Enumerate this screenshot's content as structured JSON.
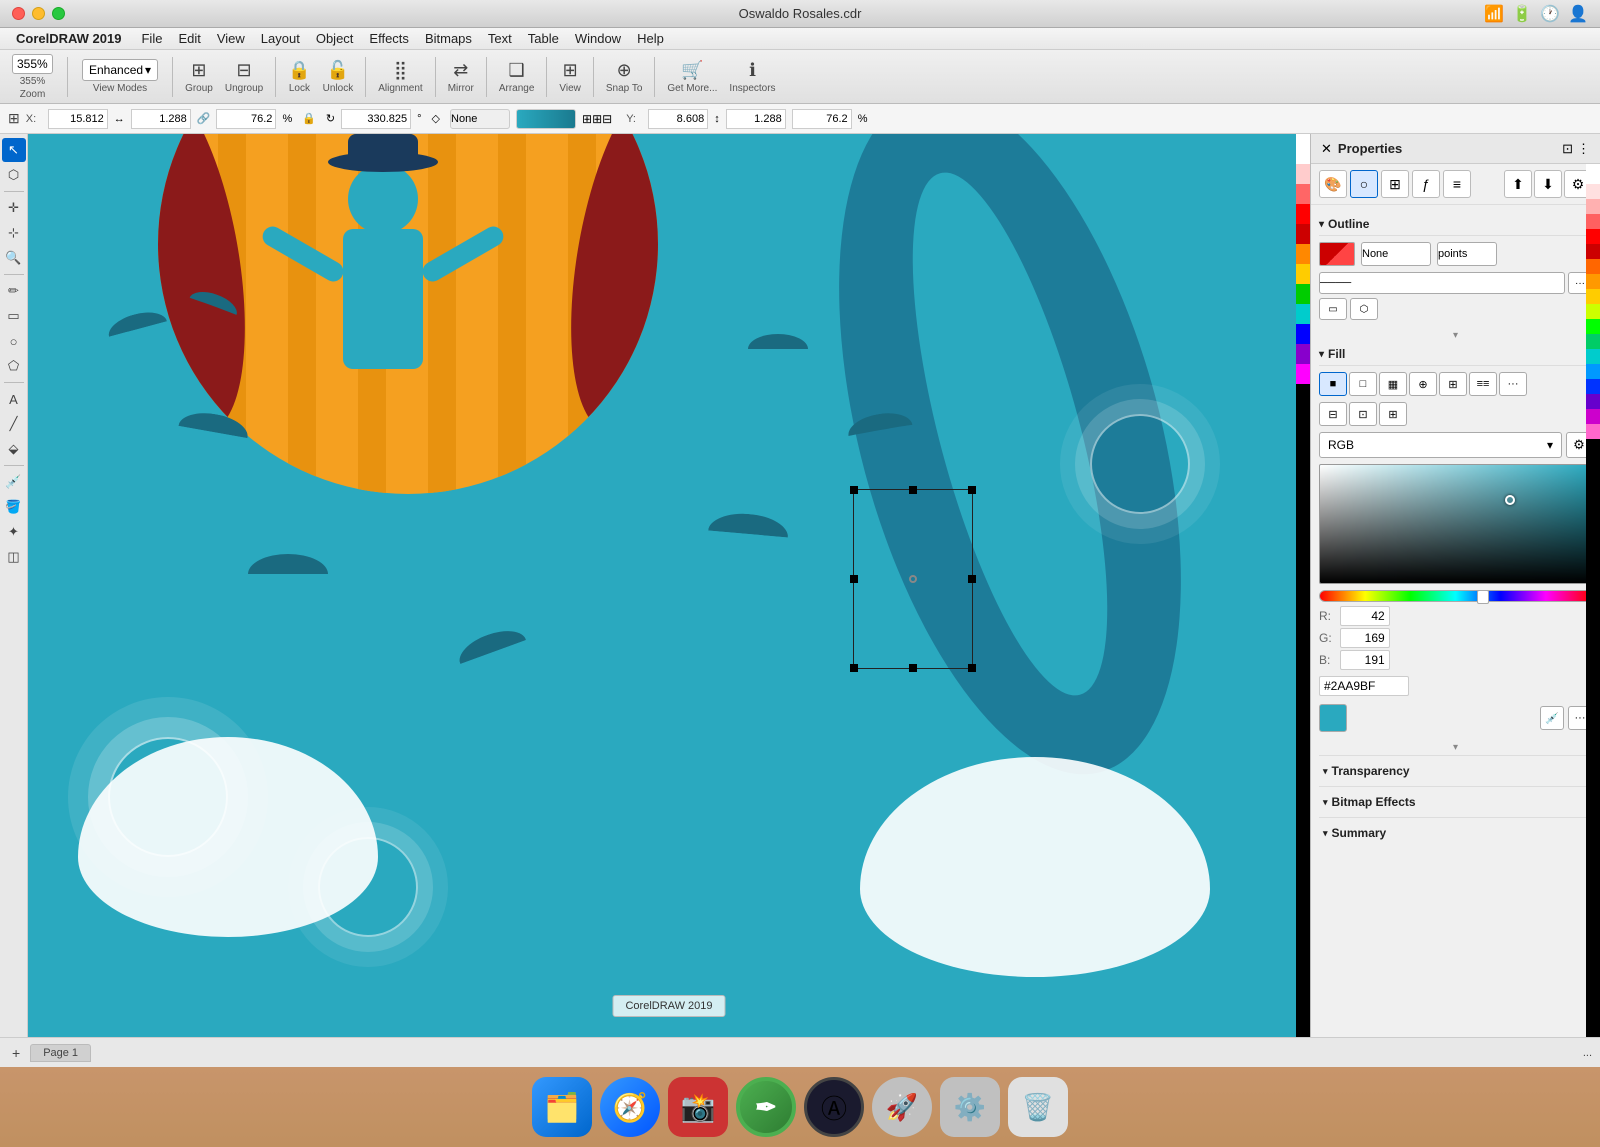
{
  "app": {
    "name": "CorelDRAW 2019",
    "title": "Oswaldo Rosales.cdr",
    "menuItems": [
      "File",
      "Edit",
      "View",
      "Layout",
      "Object",
      "Effects",
      "Bitmaps",
      "Text",
      "Table",
      "Window",
      "Help"
    ]
  },
  "toolbar": {
    "zoom": "355%",
    "viewMode": "Enhanced",
    "group": "Group",
    "ungroup": "Ungroup",
    "lock": "Lock",
    "unlock": "Unlock",
    "alignment": "Alignment",
    "mirror": "Mirror",
    "arrange": "Arrange",
    "view": "View",
    "snapTo": "Snap To",
    "getMore": "Get More...",
    "inspectors": "Inspectors"
  },
  "coords": {
    "x_label": "X:",
    "x_value": "15.812",
    "y_label": "Y:",
    "y_value": "8.608",
    "w_value": "1.288",
    "h_value": "1.288",
    "w2_value": "76.2",
    "h2_value": "76.2",
    "w_pct": "%",
    "h_pct": "%",
    "rotation": "330.825",
    "fill_type": "None"
  },
  "properties": {
    "title": "Properties",
    "sections": {
      "outline": {
        "label": "Outline",
        "noneLabel": "None",
        "pointsLabel": "points"
      },
      "fill": {
        "label": "Fill",
        "colorMode": "RGB",
        "r": 42,
        "g": 169,
        "b": 191,
        "hex": "#2AA9BF"
      },
      "transparency": {
        "label": "Transparency"
      },
      "bitmapEffects": {
        "label": "Bitmap Effects"
      },
      "summary": {
        "label": "Summary"
      }
    }
  },
  "bottomBar": {
    "pageLabel": "Page 1",
    "addPage": "+",
    "moreOptions": "..."
  },
  "watermark": {
    "text": "CorelDRAW 2019"
  },
  "dock": {
    "items": [
      {
        "name": "finder-icon",
        "label": "Finder"
      },
      {
        "name": "safari-icon",
        "label": "Safari"
      },
      {
        "name": "screenium-icon",
        "label": "Screenium"
      },
      {
        "name": "coreldraw-icon",
        "label": "CorelDRAW"
      },
      {
        "name": "autocorrect-icon",
        "label": "AutoCorrect"
      },
      {
        "name": "rocket-icon",
        "label": "Rocket"
      },
      {
        "name": "preferences-icon",
        "label": "System Preferences"
      },
      {
        "name": "trash-icon",
        "label": "Trash"
      }
    ]
  }
}
